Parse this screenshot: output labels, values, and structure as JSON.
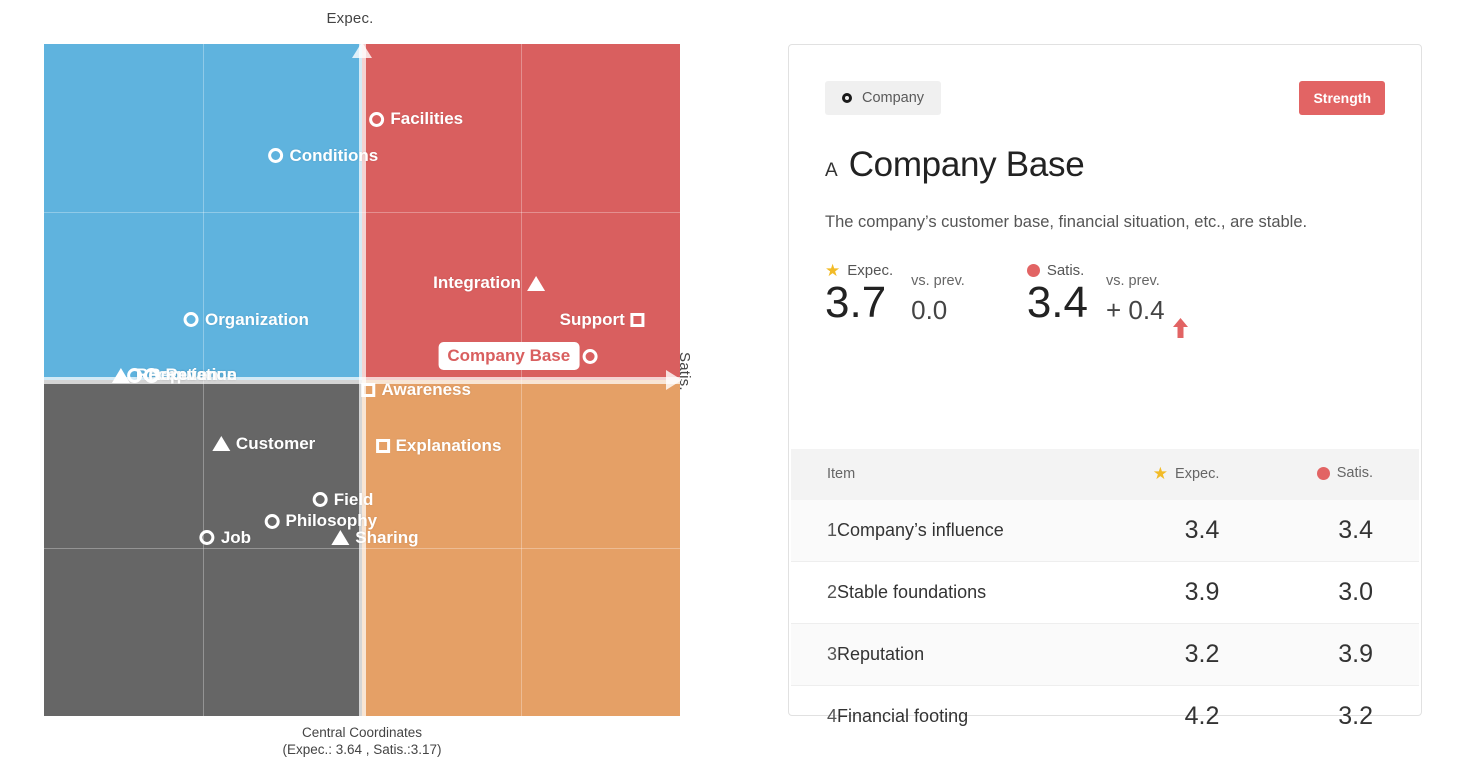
{
  "chart_data": {
    "type": "scatter",
    "title": "",
    "xlabel": "Satis.",
    "ylabel": "Expec.",
    "axis_top_label": "Expec.",
    "axis_right_label": "Satis.",
    "xlim": [
      0,
      100
    ],
    "ylim": [
      0,
      100
    ],
    "grid": true,
    "center": {
      "expec": "3.64",
      "satis": "3.17"
    },
    "caption_line1": "Central Coordinates",
    "caption_line2": "(Expec.: 3.64 , Satis.:3.17)",
    "quadrants": [
      {
        "name": "top-left",
        "color": "#5fb3de",
        "meaning": "high expectation / low satisfaction"
      },
      {
        "name": "top-right",
        "color": "#d95f5f",
        "meaning": "high expectation / high satisfaction"
      },
      {
        "name": "bottom-left",
        "color": "#666666",
        "meaning": "low expectation / low satisfaction"
      },
      {
        "name": "bottom-right",
        "color": "#e5a066",
        "meaning": "low expectation / high satisfaction"
      }
    ],
    "points": [
      {
        "label": "Facilities",
        "marker": "circle",
        "x": 59,
        "y": 11.2,
        "label_side": "right",
        "highlight": false
      },
      {
        "label": "Conditions",
        "marker": "circle",
        "x": 44.4,
        "y": 16.6,
        "label_side": "right",
        "highlight": false
      },
      {
        "label": "Integration",
        "marker": "triangle",
        "x": 69.5,
        "y": 35.6,
        "label_side": "left",
        "highlight": false
      },
      {
        "label": "Organization",
        "marker": "circle",
        "x": 32.3,
        "y": 41.0,
        "label_side": "right",
        "highlight": false
      },
      {
        "label": "Support",
        "marker": "square",
        "x": 87.3,
        "y": 41.0,
        "label_side": "left",
        "highlight": false
      },
      {
        "label": "Company Base",
        "marker": "circle",
        "x": 74.5,
        "y": 46.5,
        "label_side": "left",
        "highlight": true
      },
      {
        "label": "Reception",
        "marker": "triangle",
        "x": 19.5,
        "y": 49.3,
        "label_side": "right",
        "highlight": false
      },
      {
        "label": "Reputation",
        "marker": "circle",
        "x": 22.2,
        "y": 49.3,
        "label_side": "right",
        "highlight": false
      },
      {
        "label": "Revenue",
        "marker": "circle",
        "x": 23.5,
        "y": 49.3,
        "label_side": "right",
        "highlight": false
      },
      {
        "label": "Awareness",
        "marker": "square",
        "x": 59.0,
        "y": 51.5,
        "label_side": "right",
        "highlight": false
      },
      {
        "label": "Customer",
        "marker": "triangle",
        "x": 35.0,
        "y": 59.5,
        "label_side": "right",
        "highlight": false
      },
      {
        "label": "Explanations",
        "marker": "square",
        "x": 62.5,
        "y": 59.8,
        "label_side": "right",
        "highlight": false
      },
      {
        "label": "Field",
        "marker": "circle",
        "x": 47.5,
        "y": 67.8,
        "label_side": "right",
        "highlight": false
      },
      {
        "label": "Philosophy",
        "marker": "circle",
        "x": 44.0,
        "y": 71.0,
        "label_side": "right",
        "highlight": false
      },
      {
        "label": "Sharing",
        "marker": "triangle",
        "x": 52.5,
        "y": 73.5,
        "label_side": "right",
        "highlight": false
      },
      {
        "label": "Job",
        "marker": "circle",
        "x": 29.0,
        "y": 73.5,
        "label_side": "right",
        "highlight": false
      }
    ]
  },
  "detail": {
    "type_badge": "Company",
    "type_badge_icon": "circle-outline-icon",
    "strength_badge": "Strength",
    "rank": "A",
    "title": "Company Base",
    "description": "The company’s customer base, financial situation, etc., are stable.",
    "metrics": {
      "expec_label": "Expec.",
      "expec_value": "3.7",
      "expec_delta_label": "vs. prev.",
      "expec_delta": "0.0",
      "satis_label": "Satis.",
      "satis_value": "3.4",
      "satis_delta_label": "vs. prev.",
      "satis_delta": "+ 0.4",
      "satis_delta_direction": "up"
    },
    "table": {
      "headers": {
        "item": "Item",
        "expec": "Expec.",
        "satis": "Satis."
      },
      "rows": [
        {
          "num": "1",
          "name": "Company’s influence",
          "expec": "3.4",
          "satis": "3.4"
        },
        {
          "num": "2",
          "name": "Stable foundations",
          "expec": "3.9",
          "satis": "3.0"
        },
        {
          "num": "3",
          "name": "Reputation",
          "expec": "3.2",
          "satis": "3.9"
        },
        {
          "num": "4",
          "name": "Financial footing",
          "expec": "4.2",
          "satis": "3.2"
        }
      ]
    }
  },
  "colors": {
    "blue": "#5fb3de",
    "red": "#d95f5f",
    "gray": "#666666",
    "orange": "#e5a066",
    "accent_red": "#e26464",
    "star_yellow": "#f2bb27"
  }
}
